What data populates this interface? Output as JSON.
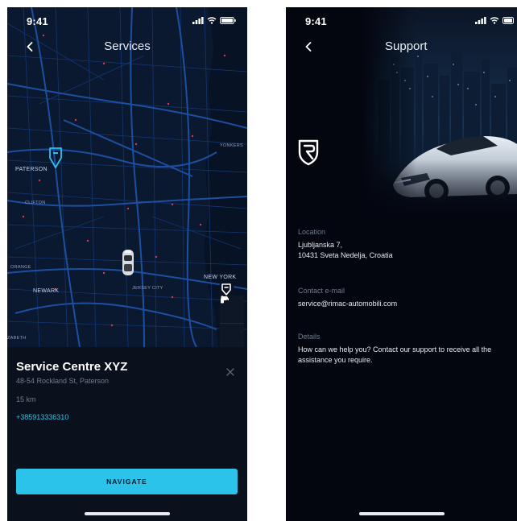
{
  "status_bar": {
    "time": "9:41"
  },
  "services_screen": {
    "title": "Services",
    "map_labels": {
      "paterson": "PATERSON",
      "clifton": "CLIFTON",
      "newark": "NEWARK",
      "orange": "ORANGE",
      "jersey_city": "JERSEY CITY",
      "new_york": "NEW YORK",
      "yonkers": "YONKERS",
      "elizabeth": "ZABETH"
    },
    "service_centre": {
      "name": "Service Centre XYZ",
      "address": "48-54 Rockland St, Paterson",
      "distance": "15 km",
      "phone": "+385913336310"
    },
    "navigate_label": "NAVIGATE",
    "icons": {
      "back": "chevron-left-icon",
      "pin": "service-pin-icon",
      "car": "car-icon",
      "person": "person-icon",
      "close": "close-icon"
    },
    "colors": {
      "accent": "#2bc3ea",
      "background": "#050a15",
      "map": "#0a1830",
      "roads": "#1d4fa0"
    }
  },
  "support_screen": {
    "title": "Support",
    "location_label": "Location",
    "location_line1": "Ljubljanska 7,",
    "location_line2": "10431 Sveta Nedelja, Croatia",
    "email_label": "Contact e-mail",
    "email": "service@rimac-automobili.com",
    "details_label": "Details",
    "details_text": "How can we help you? Contact our support to receive all the assistance you require."
  }
}
